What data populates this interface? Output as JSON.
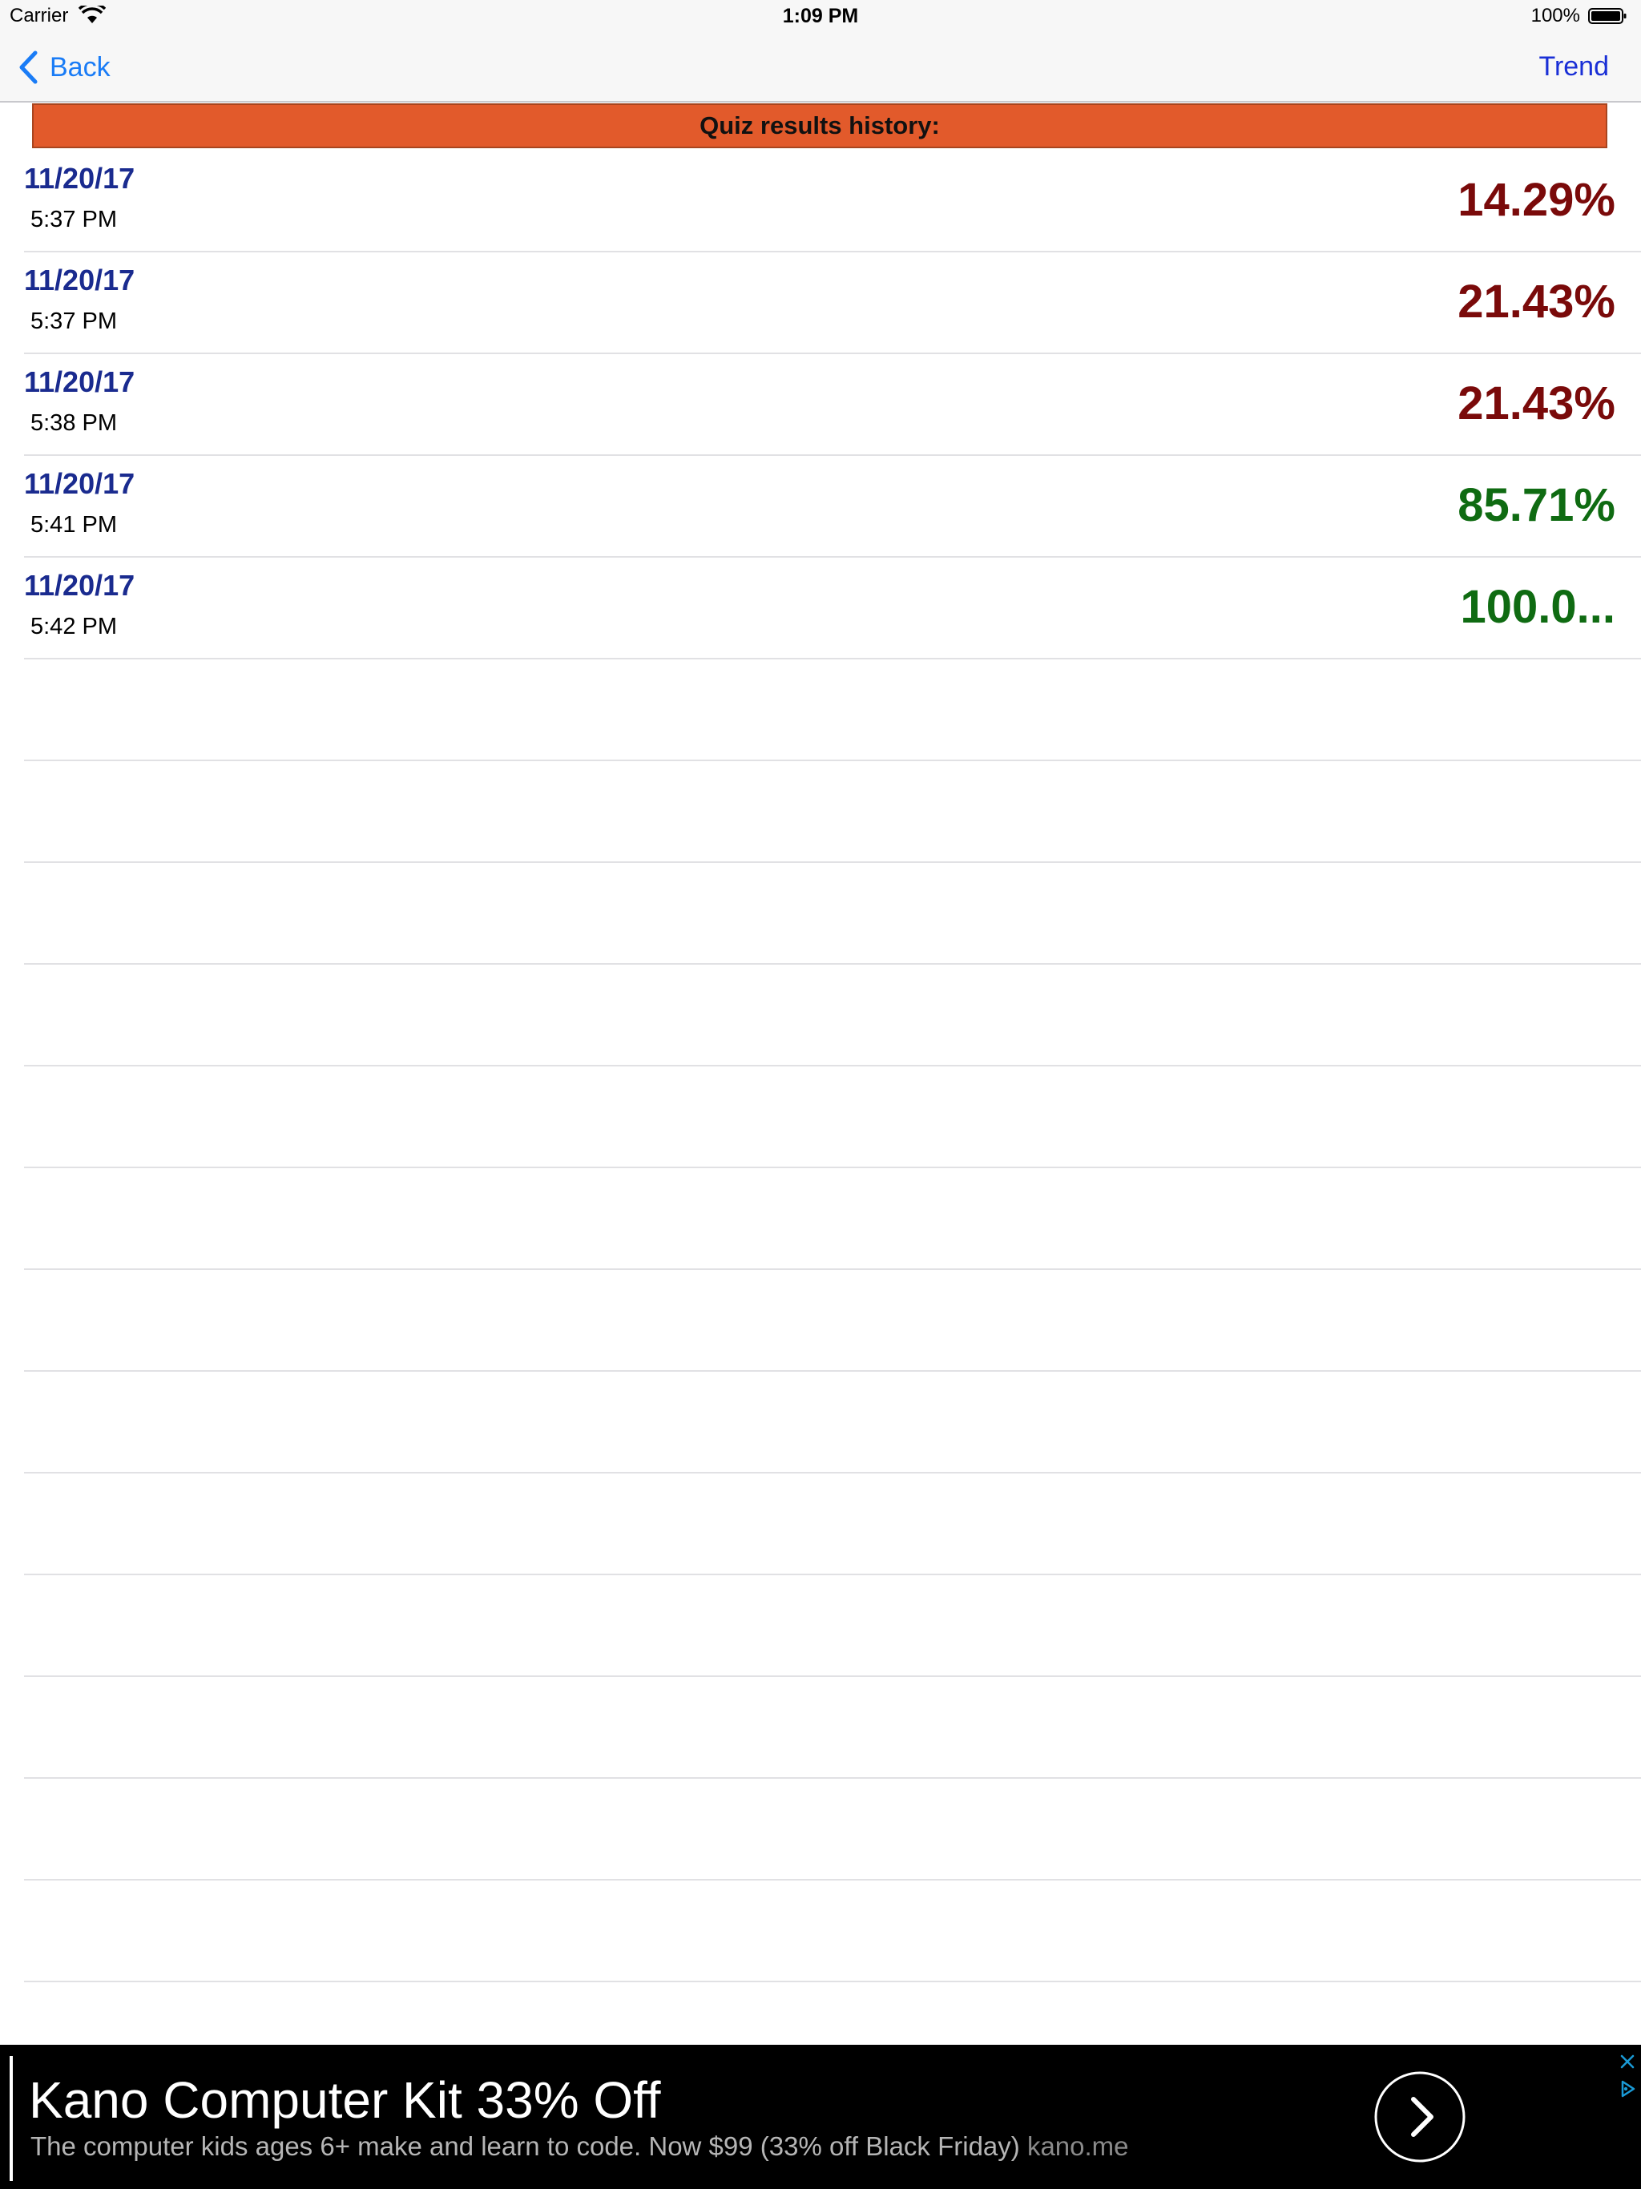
{
  "status_bar": {
    "carrier": "Carrier",
    "time": "1:09 PM",
    "battery": "100%"
  },
  "nav": {
    "back_label": "Back",
    "trend_label": "Trend"
  },
  "header": {
    "title": "Quiz results history:"
  },
  "results": [
    {
      "date": "11/20/17",
      "time": "5:37 PM",
      "score": "14.29%",
      "status": "low"
    },
    {
      "date": "11/20/17",
      "time": "5:37 PM",
      "score": "21.43%",
      "status": "low"
    },
    {
      "date": "11/20/17",
      "time": "5:38 PM",
      "score": "21.43%",
      "status": "low"
    },
    {
      "date": "11/20/17",
      "time": "5:41 PM",
      "score": "85.71%",
      "status": "high"
    },
    {
      "date": "11/20/17",
      "time": "5:42 PM",
      "score": "100.0...",
      "status": "high"
    }
  ],
  "colors": {
    "low_score": "#7a0a0a",
    "high_score": "#0f6b12",
    "date": "#1a2b8f",
    "header_bg": "#e25a2b",
    "link": "#1a7cf6"
  },
  "icons": {
    "back": "chevron-left-icon",
    "ad_go": "chevron-right-circle-icon",
    "ad_close": "close-icon",
    "ad_choices": "ad-choices-icon",
    "wifi": "wifi-icon",
    "battery": "battery-icon"
  },
  "ad": {
    "title": "Kano Computer Kit 33% Off",
    "body": "The computer kids ages 6+ make and learn to code. Now $99 (33% off Black Friday)",
    "domain": "kano.me"
  }
}
